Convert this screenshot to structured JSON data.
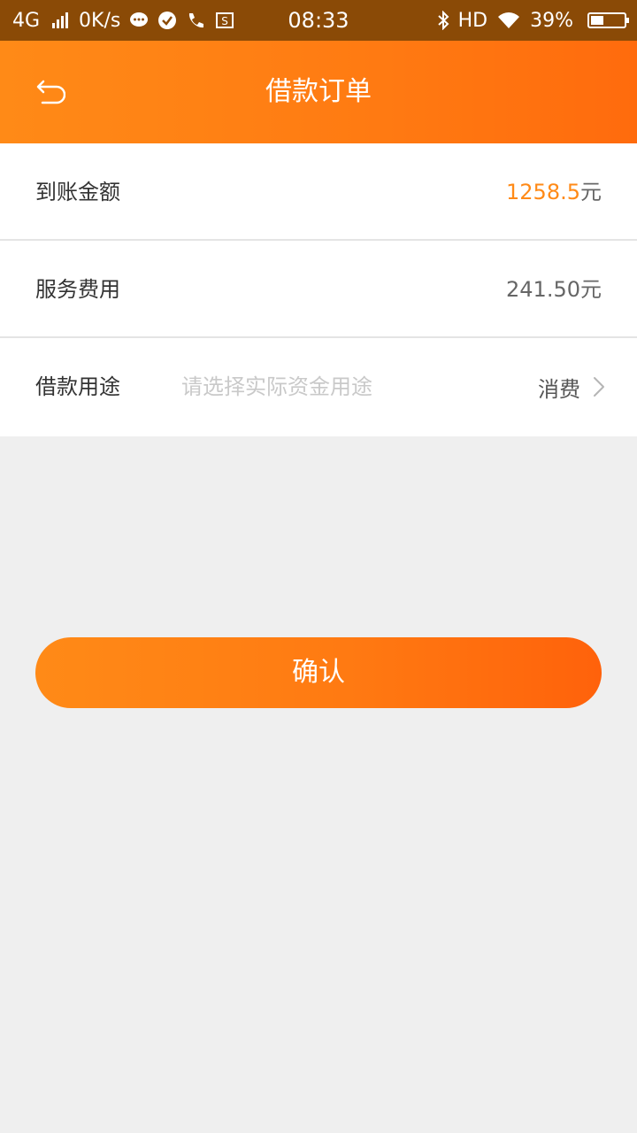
{
  "status_bar": {
    "network": "4G",
    "speed": "0K/s",
    "time": "08:33",
    "hd": "HD",
    "battery": "39%",
    "battery_level": 0.39,
    "icons": [
      "signal-icon",
      "chat-icon",
      "check-circle-icon",
      "call-icon",
      "screenshot-icon",
      "bluetooth-icon",
      "wifi-icon",
      "battery-icon"
    ]
  },
  "header": {
    "title": "借款订单",
    "back_icon": "back-icon",
    "background_color": "#ff8a17"
  },
  "rows": {
    "arrival": {
      "label": "到账金额",
      "amount": "1258.5",
      "unit": "元",
      "amount_color": "#ff8a17"
    },
    "service_fee": {
      "label": "服务费用",
      "value": "241.50元"
    },
    "purpose": {
      "label": "借款用途",
      "placeholder": "请选择实际资金用途",
      "value": "消费",
      "icon": "chevron-right-icon"
    }
  },
  "confirm": {
    "label": "确认",
    "color_start": "#ff8a17",
    "color_end": "#ff620b"
  }
}
